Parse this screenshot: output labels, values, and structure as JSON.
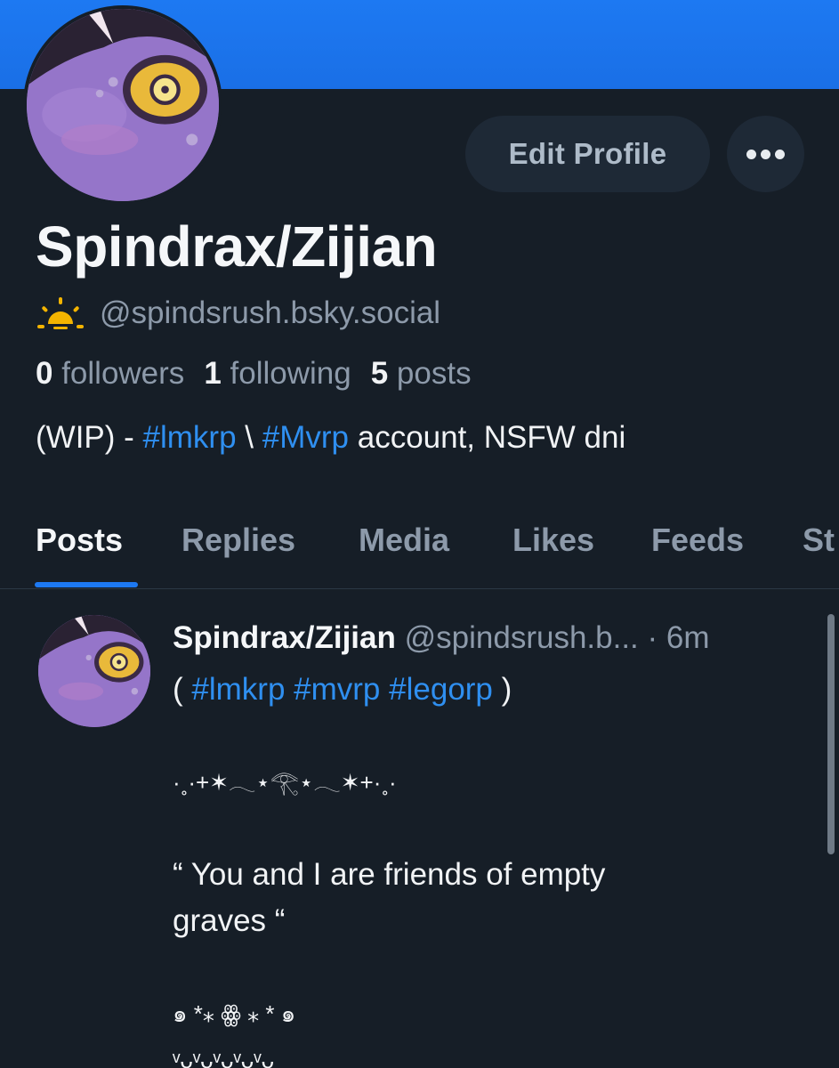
{
  "profile": {
    "display_name": "Spindrax/Zijian",
    "handle": "@spindsrush.bsky.social",
    "followers_count": "0",
    "followers_label": "followers",
    "following_count": "1",
    "following_label": "following",
    "posts_count": "5",
    "posts_label": "posts",
    "bio_prefix": "(WIP) - ",
    "bio_tag1": "#lmkrp",
    "bio_sep": " \\ ",
    "bio_tag2": "#Mvrp",
    "bio_suffix": " account, NSFW dni"
  },
  "actions": {
    "edit_profile": "Edit Profile"
  },
  "tabs": [
    {
      "label": "Posts"
    },
    {
      "label": "Replies"
    },
    {
      "label": "Media"
    },
    {
      "label": "Likes"
    },
    {
      "label": "Feeds"
    },
    {
      "label": "St"
    }
  ],
  "post": {
    "author": "Spindrax/Zijian",
    "handle": "@spindsrush.b...",
    "time": "· 6m",
    "tags_open": "( ",
    "tag1": "#lmkrp",
    "tag2": "#mvrp",
    "tag3": "#legorp",
    "tags_close": " )",
    "deco1": "·˳·+✶𓂃⋆𓂀⋆𓂃✶+·˳·",
    "quote_line1": "“ You and I are friends of empty",
    "quote_line2": "graves  “",
    "deco2": "๑ *⁎  ꙮ ⁎ * ๑",
    "deco3": "ᵛᴗᵛᴗᵛᴗᵛᴗᵛᴗ"
  },
  "colors": {
    "banner": "#1d79f2",
    "background": "#161e27",
    "accent": "#2f8ff0",
    "muted": "#8d9aaa"
  }
}
